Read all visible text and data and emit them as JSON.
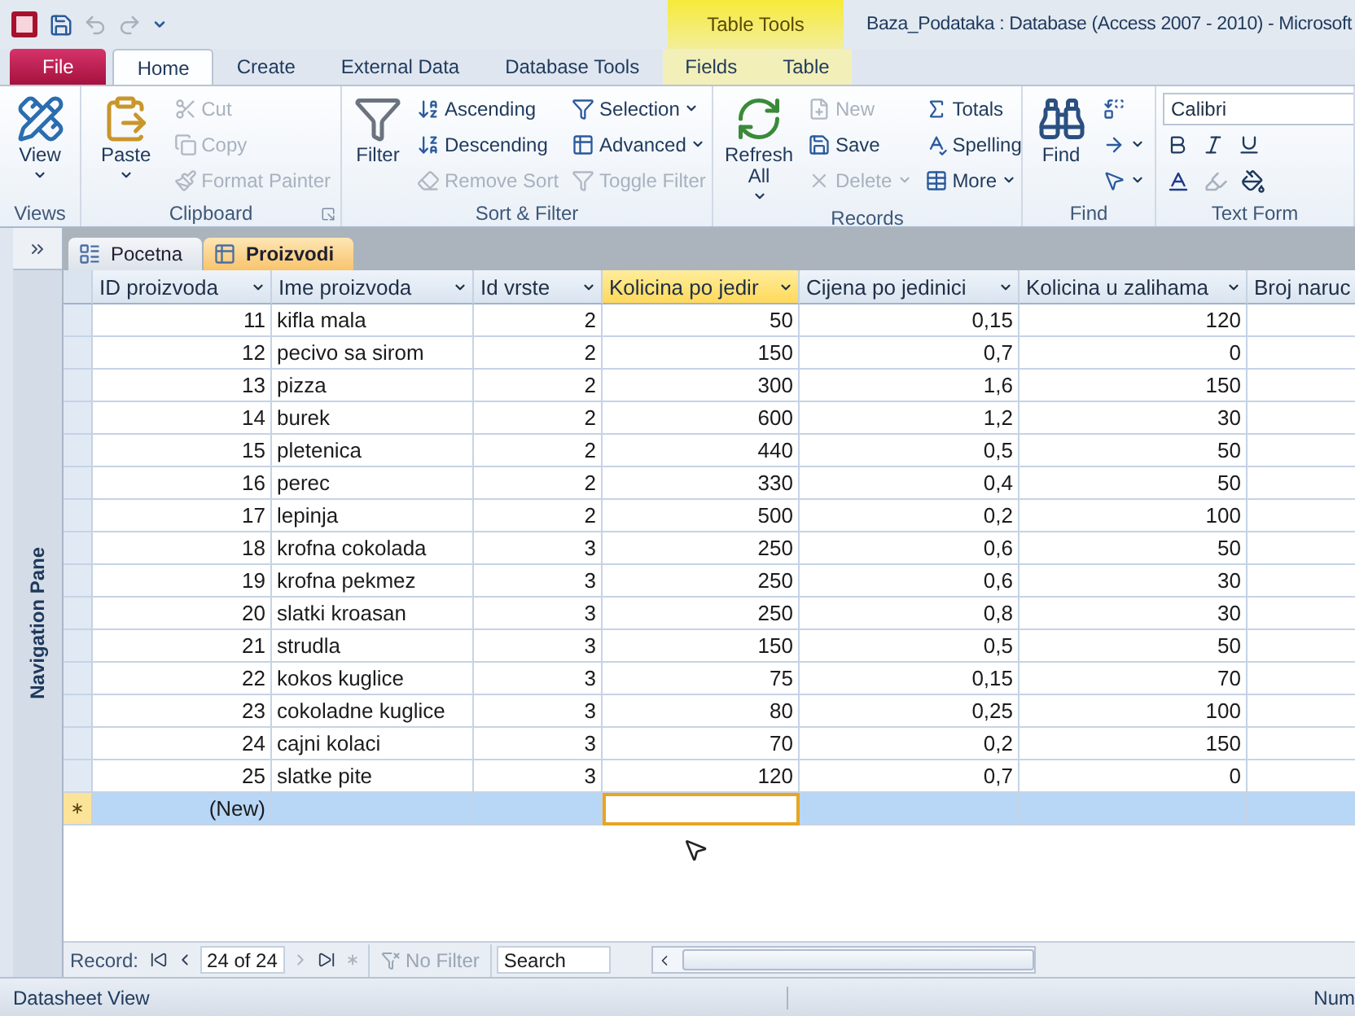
{
  "title_bar": {
    "contextual_tab": "Table Tools",
    "title": "Baza_Podataka : Database (Access 2007 - 2010)  -  Microsoft",
    "quick_access": [
      {
        "disabled": false
      },
      {
        "disabled": true
      },
      {
        "disabled": true
      }
    ]
  },
  "ribbon_tabs": [
    {
      "label": "File",
      "kind": "file",
      "selected": false
    },
    {
      "label": "Home",
      "kind": "normal",
      "selected": true
    },
    {
      "label": "Create",
      "kind": "normal",
      "selected": false
    },
    {
      "label": "External Data",
      "kind": "normal",
      "selected": false
    },
    {
      "label": "Database Tools",
      "kind": "normal",
      "selected": false
    },
    {
      "label": "Fields",
      "kind": "contextual",
      "selected": false
    },
    {
      "label": "Table",
      "kind": "contextual",
      "selected": false
    }
  ],
  "ribbon_groups": [
    {
      "label": "Views",
      "sections": [
        {
          "kind": "large",
          "label": "View",
          "dropdown": true,
          "disabled": false
        }
      ]
    },
    {
      "label": "Clipboard",
      "launcher": true,
      "sections": [
        {
          "kind": "large",
          "label": "Paste",
          "dropdown": true,
          "disabled": false
        },
        {
          "kind": "stack",
          "items": [
            {
              "label": "Cut",
              "disabled": true,
              "dropdown": false
            },
            {
              "label": "Copy",
              "disabled": true,
              "dropdown": false
            },
            {
              "label": "Format Painter",
              "disabled": true,
              "dropdown": false
            }
          ]
        }
      ]
    },
    {
      "label": "Sort & Filter",
      "sections": [
        {
          "kind": "large",
          "label": "Filter",
          "dropdown": false,
          "disabled": false
        },
        {
          "kind": "stack",
          "items": [
            {
              "label": "Ascending",
              "disabled": false,
              "dropdown": false
            },
            {
              "label": "Descending",
              "disabled": false,
              "dropdown": false
            },
            {
              "label": "Remove Sort",
              "disabled": true,
              "dropdown": false
            }
          ]
        },
        {
          "kind": "stack",
          "items": [
            {
              "label": "Selection",
              "disabled": false,
              "dropdown": true
            },
            {
              "label": "Advanced",
              "disabled": false,
              "dropdown": true
            },
            {
              "label": "Toggle Filter",
              "disabled": true,
              "dropdown": false
            }
          ]
        }
      ]
    },
    {
      "label": "Records",
      "sections": [
        {
          "kind": "large",
          "label": "Refresh All",
          "dropdown": true,
          "disabled": false
        },
        {
          "kind": "stack",
          "items": [
            {
              "label": "New",
              "disabled": true,
              "dropdown": false
            },
            {
              "label": "Save",
              "disabled": false,
              "dropdown": false
            },
            {
              "label": "Delete",
              "disabled": true,
              "dropdown": true
            }
          ]
        },
        {
          "kind": "stack",
          "items": [
            {
              "label": "Totals",
              "disabled": false,
              "dropdown": false
            },
            {
              "label": "Spelling",
              "disabled": false,
              "dropdown": false
            },
            {
              "label": "More",
              "disabled": false,
              "dropdown": true
            }
          ]
        }
      ]
    },
    {
      "label": "Find",
      "sections": [
        {
          "kind": "large",
          "label": "Find",
          "dropdown": false,
          "disabled": false
        },
        {
          "kind": "stack",
          "items": [
            {
              "disabled": false
            },
            {
              "disabled": false,
              "dropdown": true
            },
            {
              "disabled": false,
              "dropdown": true
            }
          ]
        }
      ]
    },
    {
      "label": "Text Form",
      "sections": [
        {
          "kind": "font",
          "value": "Calibri"
        }
      ]
    }
  ],
  "navigation_pane": {
    "label": "Navigation Pane"
  },
  "doc_tabs": [
    {
      "label": "Pocetna",
      "selected": false
    },
    {
      "label": "Proizvodi",
      "selected": true
    }
  ],
  "columns": [
    {
      "label": "ID proizvoda",
      "kind": "number",
      "selected": false
    },
    {
      "label": "Ime proizvoda",
      "kind": "text",
      "selected": false
    },
    {
      "label": "Id vrste",
      "kind": "number",
      "selected": false
    },
    {
      "label": "Kolicina po jedir",
      "kind": "number",
      "selected": true
    },
    {
      "label": "Cijena po jedinici",
      "kind": "number",
      "selected": false
    },
    {
      "label": "Kolicina u zalihama",
      "kind": "number",
      "selected": false
    },
    {
      "label": "Broj naruc",
      "kind": "number",
      "selected": false
    }
  ],
  "rows": [
    [
      "11",
      "kifla mala",
      "2",
      "50",
      "0,15",
      "120"
    ],
    [
      "12",
      "pecivo sa sirom",
      "2",
      "150",
      "0,7",
      "0"
    ],
    [
      "13",
      "pizza",
      "2",
      "300",
      "1,6",
      "150"
    ],
    [
      "14",
      "burek",
      "2",
      "600",
      "1,2",
      "30"
    ],
    [
      "15",
      "pletenica",
      "2",
      "440",
      "0,5",
      "50"
    ],
    [
      "16",
      "perec",
      "2",
      "330",
      "0,4",
      "50"
    ],
    [
      "17",
      "lepinja",
      "2",
      "500",
      "0,2",
      "100"
    ],
    [
      "18",
      "krofna cokolada",
      "3",
      "250",
      "0,6",
      "50"
    ],
    [
      "19",
      "krofna pekmez",
      "3",
      "250",
      "0,6",
      "30"
    ],
    [
      "20",
      "slatki kroasan",
      "3",
      "250",
      "0,8",
      "30"
    ],
    [
      "21",
      "strudla",
      "3",
      "150",
      "0,5",
      "50"
    ],
    [
      "22",
      "kokos kuglice",
      "3",
      "75",
      "0,15",
      "70"
    ],
    [
      "23",
      "cokoladne kuglice",
      "3",
      "80",
      "0,25",
      "100"
    ],
    [
      "24",
      "cajni kolaci",
      "3",
      "70",
      "0,2",
      "150"
    ],
    [
      "25",
      "slatke pite",
      "3",
      "120",
      "0,7",
      "0"
    ]
  ],
  "new_row": {
    "label": "(New)"
  },
  "record_nav": {
    "label": "Record:",
    "position": "24 of 24",
    "buttons": [
      {
        "disabled": false
      },
      {
        "disabled": false
      },
      {
        "disabled": true
      },
      {
        "disabled": false
      },
      {
        "disabled": true
      }
    ],
    "filter": {
      "label": "No Filter",
      "disabled": true
    },
    "search": {
      "placeholder": "Search"
    }
  },
  "status_bar": {
    "left": "Datasheet View",
    "right": "Num"
  }
}
